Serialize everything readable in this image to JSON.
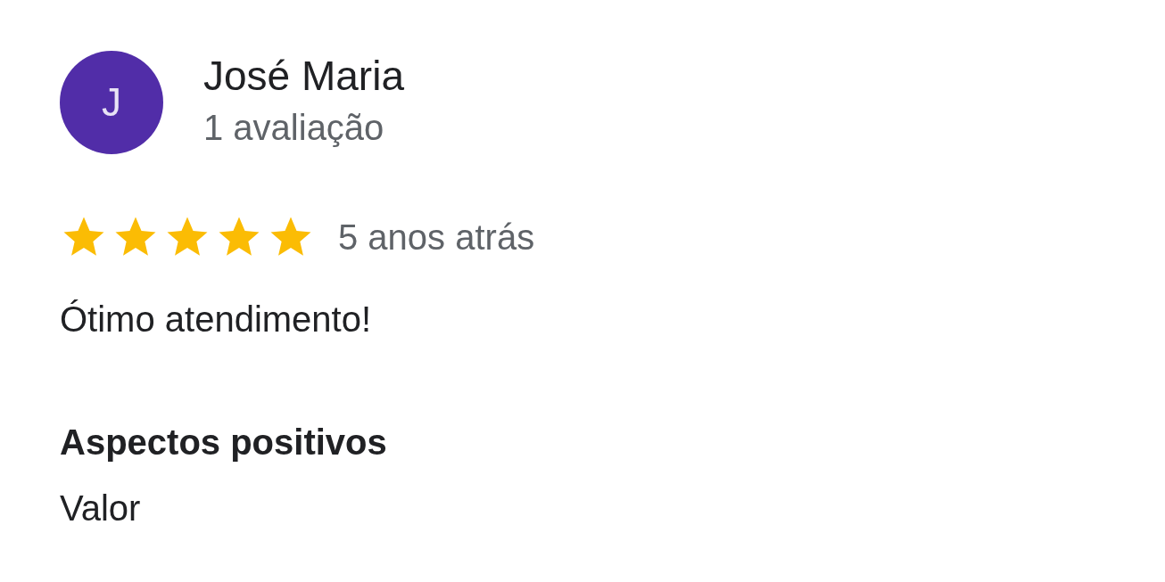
{
  "reviewer": {
    "initial": "J",
    "name": "José Maria",
    "review_count": "1 avaliação"
  },
  "review": {
    "stars": 5,
    "time": "5 anos atrás",
    "text": "Ótimo atendimento!"
  },
  "highlights": {
    "title": "Aspectos positivos",
    "items": [
      "Valor"
    ]
  }
}
